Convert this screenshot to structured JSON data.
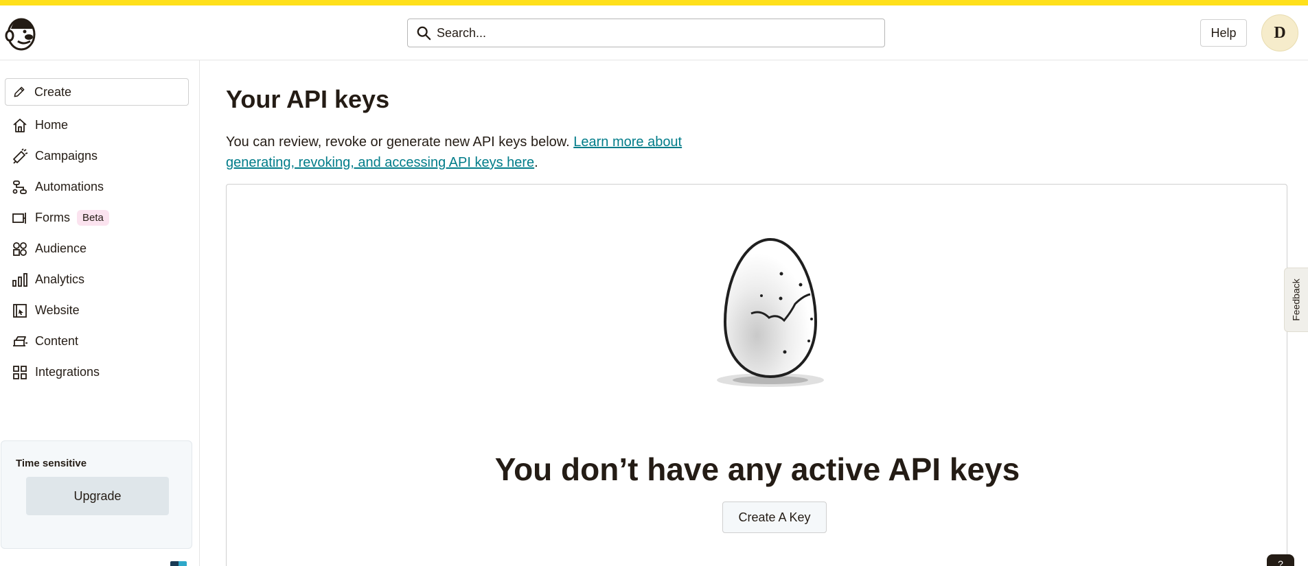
{
  "header": {
    "search_placeholder": "Search...",
    "help_label": "Help",
    "avatar_initial": "D"
  },
  "sidebar": {
    "create_label": "Create",
    "items": [
      {
        "label": "Home",
        "icon": "home-icon"
      },
      {
        "label": "Campaigns",
        "icon": "megaphone-icon"
      },
      {
        "label": "Automations",
        "icon": "automation-icon"
      },
      {
        "label": "Forms",
        "icon": "form-icon",
        "badge": "Beta"
      },
      {
        "label": "Audience",
        "icon": "audience-icon"
      },
      {
        "label": "Analytics",
        "icon": "bar-chart-icon"
      },
      {
        "label": "Website",
        "icon": "website-icon"
      },
      {
        "label": "Content",
        "icon": "content-icon"
      },
      {
        "label": "Integrations",
        "icon": "grid-icon"
      }
    ],
    "upgrade": {
      "heading": "Time sensitive",
      "button_label": "Upgrade"
    }
  },
  "main": {
    "title": "Your API keys",
    "description_prefix": "You can review, revoke or generate new API keys below. ",
    "description_link": "Learn more about generating, revoking, and accessing API keys here",
    "description_suffix": ".",
    "empty_state": {
      "title": "You don’t have any active API keys",
      "button_label": "Create A Key"
    }
  },
  "feedback_label": "Feedback",
  "help_fab_label": "?",
  "colors": {
    "accent_yellow": "#ffe01b",
    "link_teal": "#007c89",
    "text": "#241c15"
  }
}
